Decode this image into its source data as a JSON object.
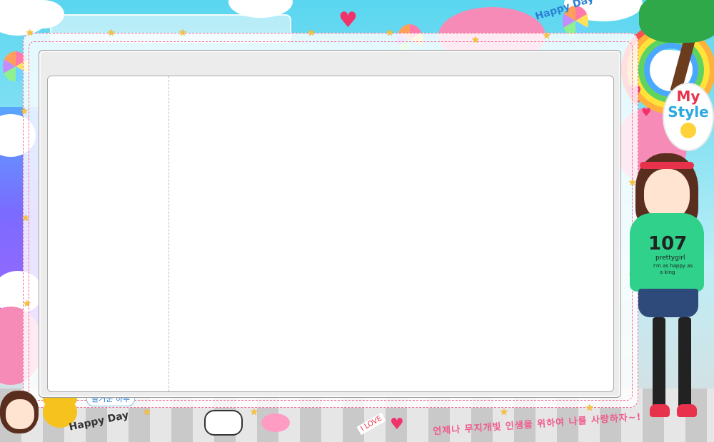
{
  "window": {
    "title": ""
  },
  "decor": {
    "happy_day_top": "Happy Day",
    "my_style_line1": "My",
    "my_style_line2": "Style",
    "shirt_number": "107",
    "shirt_brand": "prettygirl",
    "shirt_line1": "I'm as happy as",
    "shirt_line2": "a king",
    "bubble_text": "즐거운 하루",
    "bottom_left_text": "Happy Day",
    "i_love_sign": "I LOVE",
    "bottom_caption": "언제나 무지개빛 인생을 위하여 나를 사랑하자~!"
  },
  "colors": {
    "frame_dash": "#f36a92",
    "panel_bg": "#ececec",
    "content_bg": "#ffffff",
    "accent_pink": "#f0346b",
    "sky": "#5ad6f0"
  },
  "content": {
    "left_pane_text": "",
    "right_pane_text": ""
  }
}
